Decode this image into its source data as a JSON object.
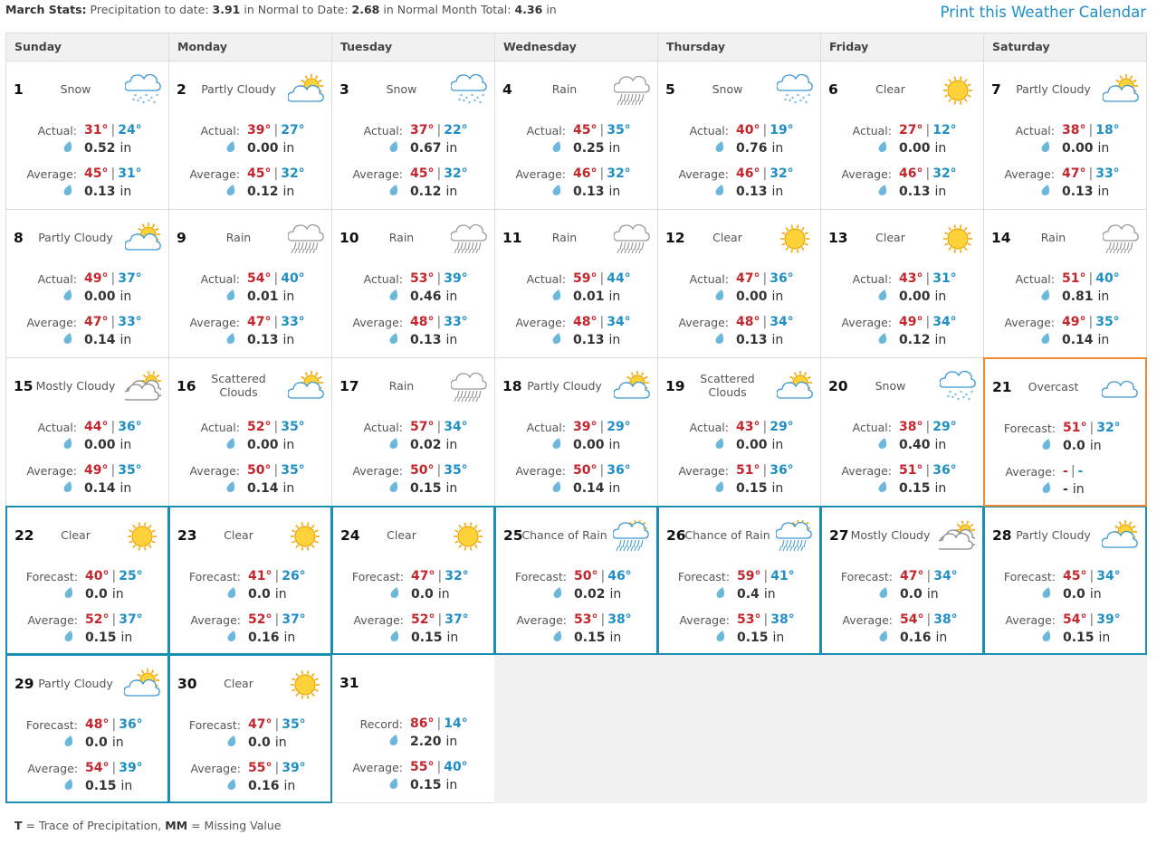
{
  "header": {
    "stats": {
      "label": "March Stats:",
      "precip_label": "Precipitation to date:",
      "precip_value": "3.91",
      "normal_label": "in Normal to Date:",
      "normal_value": "2.68",
      "month_label": "in Normal Month Total:",
      "month_value": "4.36",
      "month_unit": "in"
    },
    "print_link": "Print this Weather Calendar"
  },
  "weekdays": [
    "Sunday",
    "Monday",
    "Tuesday",
    "Wednesday",
    "Thursday",
    "Friday",
    "Saturday"
  ],
  "unit": "in",
  "colors": {
    "high": "#c3262c",
    "low": "#1f8fc6",
    "forecast_border": "#1b8fb2",
    "today_border": "#ef8a34",
    "link": "#1f8fc6"
  },
  "days": [
    {
      "day": "1",
      "cond": "Snow",
      "icon": "snow-icon",
      "kind": "actual",
      "l1": "Actual:",
      "h1": "31°",
      "lo1": "24°",
      "p1": "0.52",
      "l2": "Average:",
      "h2": "45°",
      "lo2": "31°",
      "p2": "0.13"
    },
    {
      "day": "2",
      "cond": "Partly Cloudy",
      "icon": "partly-cloudy-icon",
      "kind": "actual",
      "l1": "Actual:",
      "h1": "39°",
      "lo1": "27°",
      "p1": "0.00",
      "l2": "Average:",
      "h2": "45°",
      "lo2": "32°",
      "p2": "0.12"
    },
    {
      "day": "3",
      "cond": "Snow",
      "icon": "snow-icon",
      "kind": "actual",
      "l1": "Actual:",
      "h1": "37°",
      "lo1": "22°",
      "p1": "0.67",
      "l2": "Average:",
      "h2": "45°",
      "lo2": "32°",
      "p2": "0.12"
    },
    {
      "day": "4",
      "cond": "Rain",
      "icon": "rain-icon",
      "kind": "actual",
      "l1": "Actual:",
      "h1": "45°",
      "lo1": "35°",
      "p1": "0.25",
      "l2": "Average:",
      "h2": "46°",
      "lo2": "32°",
      "p2": "0.13"
    },
    {
      "day": "5",
      "cond": "Snow",
      "icon": "snow-icon",
      "kind": "actual",
      "l1": "Actual:",
      "h1": "40°",
      "lo1": "19°",
      "p1": "0.76",
      "l2": "Average:",
      "h2": "46°",
      "lo2": "32°",
      "p2": "0.13"
    },
    {
      "day": "6",
      "cond": "Clear",
      "icon": "sun-icon",
      "kind": "actual",
      "l1": "Actual:",
      "h1": "27°",
      "lo1": "12°",
      "p1": "0.00",
      "l2": "Average:",
      "h2": "46°",
      "lo2": "32°",
      "p2": "0.13"
    },
    {
      "day": "7",
      "cond": "Partly Cloudy",
      "icon": "partly-cloudy-icon",
      "kind": "actual",
      "l1": "Actual:",
      "h1": "38°",
      "lo1": "18°",
      "p1": "0.00",
      "l2": "Average:",
      "h2": "47°",
      "lo2": "33°",
      "p2": "0.13"
    },
    {
      "day": "8",
      "cond": "Partly Cloudy",
      "icon": "partly-cloudy-icon",
      "kind": "actual",
      "l1": "Actual:",
      "h1": "49°",
      "lo1": "37°",
      "p1": "0.00",
      "l2": "Average:",
      "h2": "47°",
      "lo2": "33°",
      "p2": "0.14"
    },
    {
      "day": "9",
      "cond": "Rain",
      "icon": "rain-icon",
      "kind": "actual",
      "l1": "Actual:",
      "h1": "54°",
      "lo1": "40°",
      "p1": "0.01",
      "l2": "Average:",
      "h2": "47°",
      "lo2": "33°",
      "p2": "0.13"
    },
    {
      "day": "10",
      "cond": "Rain",
      "icon": "rain-icon",
      "kind": "actual",
      "l1": "Actual:",
      "h1": "53°",
      "lo1": "39°",
      "p1": "0.46",
      "l2": "Average:",
      "h2": "48°",
      "lo2": "33°",
      "p2": "0.13"
    },
    {
      "day": "11",
      "cond": "Rain",
      "icon": "rain-icon",
      "kind": "actual",
      "l1": "Actual:",
      "h1": "59°",
      "lo1": "44°",
      "p1": "0.01",
      "l2": "Average:",
      "h2": "48°",
      "lo2": "34°",
      "p2": "0.13"
    },
    {
      "day": "12",
      "cond": "Clear",
      "icon": "sun-icon",
      "kind": "actual",
      "l1": "Actual:",
      "h1": "47°",
      "lo1": "36°",
      "p1": "0.00",
      "l2": "Average:",
      "h2": "48°",
      "lo2": "34°",
      "p2": "0.13"
    },
    {
      "day": "13",
      "cond": "Clear",
      "icon": "sun-icon",
      "kind": "actual",
      "l1": "Actual:",
      "h1": "43°",
      "lo1": "31°",
      "p1": "0.00",
      "l2": "Average:",
      "h2": "49°",
      "lo2": "34°",
      "p2": "0.12"
    },
    {
      "day": "14",
      "cond": "Rain",
      "icon": "rain-icon",
      "kind": "actual",
      "l1": "Actual:",
      "h1": "51°",
      "lo1": "40°",
      "p1": "0.81",
      "l2": "Average:",
      "h2": "49°",
      "lo2": "35°",
      "p2": "0.14"
    },
    {
      "day": "15",
      "cond": "Mostly Cloudy",
      "icon": "mostly-cloudy-icon",
      "kind": "actual",
      "l1": "Actual:",
      "h1": "44°",
      "lo1": "36°",
      "p1": "0.00",
      "l2": "Average:",
      "h2": "49°",
      "lo2": "35°",
      "p2": "0.14"
    },
    {
      "day": "16",
      "cond": "Scattered Clouds",
      "icon": "partly-cloudy-icon",
      "kind": "actual",
      "l1": "Actual:",
      "h1": "52°",
      "lo1": "35°",
      "p1": "0.00",
      "l2": "Average:",
      "h2": "50°",
      "lo2": "35°",
      "p2": "0.14"
    },
    {
      "day": "17",
      "cond": "Rain",
      "icon": "rain-icon",
      "kind": "actual",
      "l1": "Actual:",
      "h1": "57°",
      "lo1": "34°",
      "p1": "0.02",
      "l2": "Average:",
      "h2": "50°",
      "lo2": "35°",
      "p2": "0.15"
    },
    {
      "day": "18",
      "cond": "Partly Cloudy",
      "icon": "partly-cloudy-icon",
      "kind": "actual",
      "l1": "Actual:",
      "h1": "39°",
      "lo1": "29°",
      "p1": "0.00",
      "l2": "Average:",
      "h2": "50°",
      "lo2": "36°",
      "p2": "0.14"
    },
    {
      "day": "19",
      "cond": "Scattered Clouds",
      "icon": "partly-cloudy-icon",
      "kind": "actual",
      "l1": "Actual:",
      "h1": "43°",
      "lo1": "29°",
      "p1": "0.00",
      "l2": "Average:",
      "h2": "51°",
      "lo2": "36°",
      "p2": "0.15"
    },
    {
      "day": "20",
      "cond": "Snow",
      "icon": "snow-icon",
      "kind": "actual",
      "l1": "Actual:",
      "h1": "38°",
      "lo1": "29°",
      "p1": "0.40",
      "l2": "Average:",
      "h2": "51°",
      "lo2": "36°",
      "p2": "0.15"
    },
    {
      "day": "21",
      "cond": "Overcast",
      "icon": "overcast-icon",
      "kind": "today",
      "l1": "Forecast:",
      "h1": "51°",
      "lo1": "32°",
      "p1": "0.0",
      "l2": "Average:",
      "h2": "-",
      "lo2": "-",
      "p2": "-"
    },
    {
      "day": "22",
      "cond": "Clear",
      "icon": "sun-icon",
      "kind": "forecast",
      "l1": "Forecast:",
      "h1": "40°",
      "lo1": "25°",
      "p1": "0.0",
      "l2": "Average:",
      "h2": "52°",
      "lo2": "37°",
      "p2": "0.15"
    },
    {
      "day": "23",
      "cond": "Clear",
      "icon": "sun-icon",
      "kind": "forecast",
      "l1": "Forecast:",
      "h1": "41°",
      "lo1": "26°",
      "p1": "0.0",
      "l2": "Average:",
      "h2": "52°",
      "lo2": "37°",
      "p2": "0.16"
    },
    {
      "day": "24",
      "cond": "Clear",
      "icon": "sun-icon",
      "kind": "forecast",
      "l1": "Forecast:",
      "h1": "47°",
      "lo1": "32°",
      "p1": "0.0",
      "l2": "Average:",
      "h2": "52°",
      "lo2": "37°",
      "p2": "0.15"
    },
    {
      "day": "25",
      "cond": "Chance of Rain",
      "icon": "chance-of-rain-icon",
      "kind": "forecast",
      "l1": "Forecast:",
      "h1": "50°",
      "lo1": "46°",
      "p1": "0.02",
      "l2": "Average:",
      "h2": "53°",
      "lo2": "38°",
      "p2": "0.15"
    },
    {
      "day": "26",
      "cond": "Chance of Rain",
      "icon": "chance-of-rain-icon",
      "kind": "forecast",
      "l1": "Forecast:",
      "h1": "59°",
      "lo1": "41°",
      "p1": "0.4",
      "l2": "Average:",
      "h2": "53°",
      "lo2": "38°",
      "p2": "0.15"
    },
    {
      "day": "27",
      "cond": "Mostly Cloudy",
      "icon": "mostly-cloudy-icon",
      "kind": "forecast",
      "l1": "Forecast:",
      "h1": "47°",
      "lo1": "34°",
      "p1": "0.0",
      "l2": "Average:",
      "h2": "54°",
      "lo2": "38°",
      "p2": "0.16"
    },
    {
      "day": "28",
      "cond": "Partly Cloudy",
      "icon": "partly-cloudy-icon",
      "kind": "forecast",
      "l1": "Forecast:",
      "h1": "45°",
      "lo1": "34°",
      "p1": "0.0",
      "l2": "Average:",
      "h2": "54°",
      "lo2": "39°",
      "p2": "0.15"
    },
    {
      "day": "29",
      "cond": "Partly Cloudy",
      "icon": "partly-cloudy-icon",
      "kind": "forecast",
      "l1": "Forecast:",
      "h1": "48°",
      "lo1": "36°",
      "p1": "0.0",
      "l2": "Average:",
      "h2": "54°",
      "lo2": "39°",
      "p2": "0.15"
    },
    {
      "day": "30",
      "cond": "Clear",
      "icon": "sun-icon",
      "kind": "forecast",
      "l1": "Forecast:",
      "h1": "47°",
      "lo1": "35°",
      "p1": "0.0",
      "l2": "Average:",
      "h2": "55°",
      "lo2": "39°",
      "p2": "0.16"
    },
    {
      "day": "31",
      "cond": "",
      "icon": "",
      "kind": "record",
      "l1": "Record:",
      "h1": "86°",
      "lo1": "14°",
      "p1": "2.20",
      "l2": "Average:",
      "h2": "55°",
      "lo2": "40°",
      "p2": "0.15"
    }
  ],
  "legend": {
    "t_key": "T",
    "t_text": "= Trace of Precipitation,",
    "mm_key": "MM",
    "mm_text": "= Missing Value"
  }
}
